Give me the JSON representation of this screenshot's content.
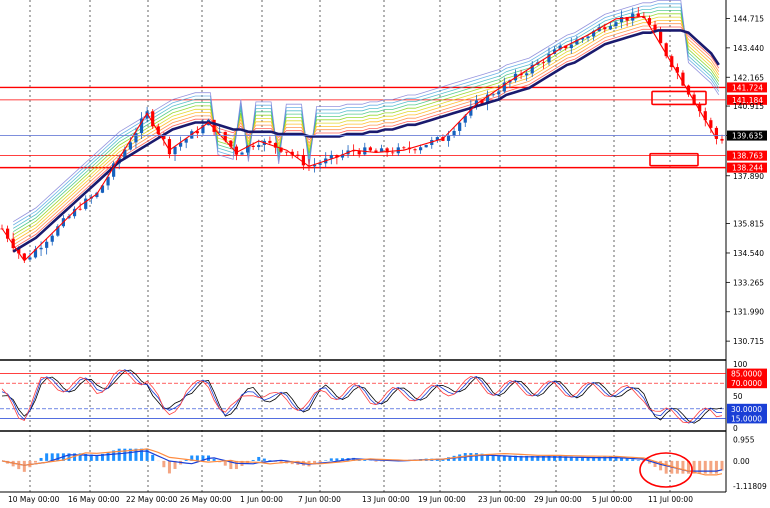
{
  "chart_data": [
    {
      "type": "candlestick",
      "panel": "price",
      "y_ticks": [
        "144.715",
        "143.440",
        "142.165",
        "140.915",
        "139.635",
        "137.890",
        "135.815",
        "134.540",
        "133.265",
        "131.990",
        "130.715"
      ],
      "ylim": [
        130.2,
        145.3
      ],
      "current_price": "139.635",
      "levels": [
        {
          "value": 141.724,
          "label": "141.724",
          "color": "#ff0000"
        },
        {
          "value": 141.184,
          "label": "141.184",
          "color": "#ff0000"
        },
        {
          "value": 138.763,
          "label": "138.763",
          "color": "#ff0000"
        },
        {
          "value": 138.244,
          "label": "138.244",
          "color": "#ff0000"
        }
      ],
      "zigzag": [
        [
          0,
          135.6
        ],
        [
          4,
          134.2
        ],
        [
          14,
          136.6
        ],
        [
          17,
          137.1
        ],
        [
          26,
          140.6
        ],
        [
          30,
          139.0
        ],
        [
          37,
          140.2
        ],
        [
          42,
          138.9
        ],
        [
          46,
          139.4
        ],
        [
          51,
          139.0
        ],
        [
          55,
          138.3
        ],
        [
          60,
          138.7
        ],
        [
          63,
          139.0
        ],
        [
          67,
          138.9
        ],
        [
          72,
          139.0
        ],
        [
          79,
          139.5
        ],
        [
          85,
          141.0
        ],
        [
          91,
          142.0
        ],
        [
          100,
          143.4
        ],
        [
          105,
          144.0
        ],
        [
          110,
          144.7
        ],
        [
          115,
          144.8
        ],
        [
          128,
          139.5
        ]
      ],
      "ma": [
        134.6,
        134.8,
        135.0,
        135.2,
        135.5,
        135.8,
        136.1,
        136.4,
        136.7,
        137.0,
        137.3,
        137.6,
        137.9,
        138.2,
        138.5,
        138.7,
        138.9,
        139.1,
        139.3,
        139.5,
        139.7,
        139.9,
        140.0,
        140.1,
        140.2,
        140.2,
        140.2,
        140.1,
        140.0,
        139.9,
        139.9,
        139.8,
        139.8,
        139.8,
        139.8,
        139.7,
        139.7,
        139.7,
        139.7,
        139.6,
        139.6,
        139.6,
        139.6,
        139.6,
        139.7,
        139.7,
        139.7,
        139.8,
        139.8,
        139.9,
        139.9,
        140.0,
        140.1,
        140.1,
        140.2,
        140.3,
        140.4,
        140.5,
        140.6,
        140.7,
        140.8,
        140.9,
        141.0,
        141.1,
        141.2,
        141.4,
        141.5,
        141.6,
        141.7,
        141.9,
        142.1,
        142.3,
        142.5,
        142.7,
        142.8,
        143.0,
        143.2,
        143.4,
        143.6,
        143.7,
        143.8,
        143.9,
        144.0,
        144.1,
        144.1,
        144.2,
        144.2,
        144.2,
        144.2,
        144.1,
        143.8,
        143.5,
        143.2,
        142.7
      ],
      "candles": "generated",
      "x_labels": [
        "10 May 00:00",
        "16 May 00:00",
        "22 May 00:00",
        "26 May 00:00",
        "1 Jun 00:00",
        "7 Jun 00:00",
        "13 Jun 00:00",
        "19 Jun 00:00",
        "23 Jun 00:00",
        "29 Jun 00:00",
        "5 Jul 00:00",
        "11 Jul 00:00"
      ]
    },
    {
      "type": "line",
      "panel": "oscillator",
      "levels": [
        {
          "value": 85,
          "label": "85.0000"
        },
        {
          "value": 70,
          "label": "70.0000"
        },
        {
          "value": 30,
          "label": "30.0000"
        },
        {
          "value": 15,
          "label": "15.0000"
        }
      ],
      "axis_labels": [
        "100",
        "50",
        "0"
      ],
      "ylim": [
        0,
        100
      ]
    },
    {
      "type": "bar",
      "panel": "macd",
      "axis_labels": [
        "0.955",
        "0.00",
        "-1.11809"
      ],
      "ylim": [
        -1.3,
        1.2
      ]
    }
  ],
  "colors": {
    "up": "#1560bd",
    "down": "#ff0000",
    "ma": "#1a1a6e",
    "level": "#ff0000",
    "grid": "#000000",
    "hist_up": "#1e90ff",
    "hist_down": "#f4a582"
  }
}
